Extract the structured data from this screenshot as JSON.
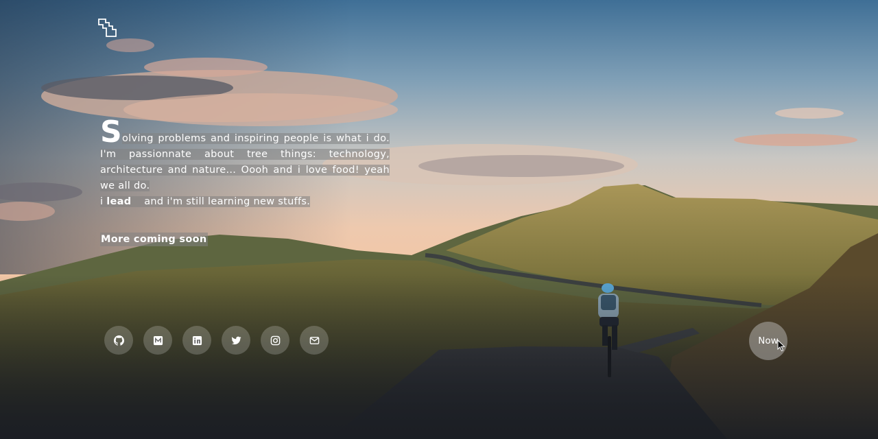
{
  "hero": {
    "dropcap": "S",
    "line1_rest": "olving problems and inspiring people is what i do.",
    "line2": "I'm passionnate about tree things: technology, architecture and nature... Oooh and i love food! yeah we all do.",
    "lead_prefix": "i ",
    "lead_word": "lead",
    "lead_suffix": "and i'm still learning new stuffs.",
    "coming_soon": "More coming soon"
  },
  "socials": [
    {
      "icon": "github-icon"
    },
    {
      "icon": "medium-icon"
    },
    {
      "icon": "linkedin-icon"
    },
    {
      "icon": "twitter-icon"
    },
    {
      "icon": "instagram-icon"
    },
    {
      "icon": "mail-icon"
    }
  ],
  "now_button": {
    "label": "Now"
  }
}
